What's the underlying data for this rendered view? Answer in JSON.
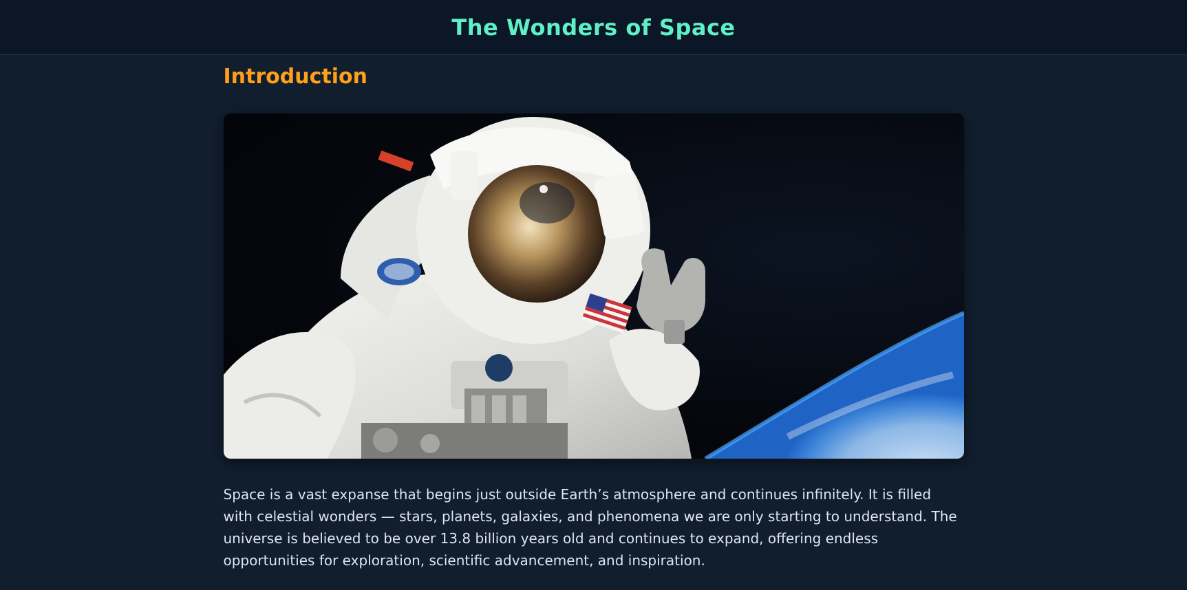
{
  "header": {
    "title": "The Wonders of Space"
  },
  "main": {
    "section_title": "Introduction",
    "hero_image": {
      "icon": "astronaut-image"
    },
    "paragraph": "Space is a vast expanse that begins just outside Earth’s atmosphere and continues infinitely. It is filled with celestial wonders — stars, planets, galaxies, and phenomena we are only starting to understand. The universe is believed to be over 13.8 billion years old and continues to expand, offering endless opportunities for exploration, scientific advancement, and inspiration."
  },
  "colors": {
    "header_bg": "#0b1627",
    "page_bg": "#111e2e",
    "title_accent": "#5ff0c6",
    "section_accent": "#ff9f1a",
    "body_text": "#dfe6f0"
  }
}
